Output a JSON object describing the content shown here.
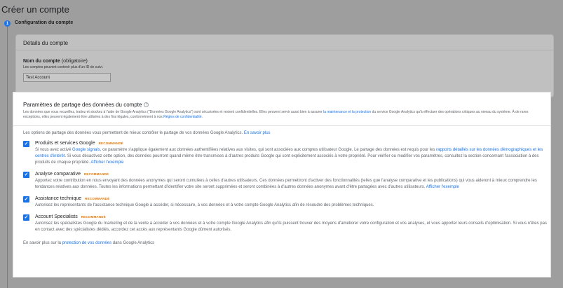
{
  "page": {
    "title": "Créer un compte",
    "step_number": "1",
    "step_label": "Configuration du compte"
  },
  "account_details": {
    "header": "Détails du compte",
    "name_label": "Nom du compte",
    "name_optional": "(obligatoire)",
    "name_help": "Les comptes peuvent contenir plus d'un ID de suivi.",
    "name_value": "Test Account"
  },
  "sharing": {
    "title": "Paramètres de partage des données du compte",
    "help_icon": "?",
    "desc_part1": "Les données que vous recueillez, traitez et stockez à l'aide de Google Analytics (\"Données Google Analytics\") sont sécurisées et restent confidentielles. Elles peuvent servir aussi bien à assurer ",
    "desc_link1": "la maintenance et la protection",
    "desc_part2": " du service Google Analytics qu'à effectuer des opérations critiques au niveau du système. À de rares exceptions, elles peuvent également être utilisées à des fins légales, conformément à nos ",
    "desc_link2": "Règles de confidentialité",
    "desc_part3": ".",
    "intro_text": "Les options de partage des données vous permettent de mieux contrôler le partage de vos données Google Analytics. ",
    "intro_link": "En savoir plus",
    "badge": "RECOMMANDÉ",
    "options": [
      {
        "title": "Produits et services Google",
        "checked": true,
        "desc_a": "Si vous avez activé ",
        "link_a": "Google signals",
        "desc_b": ", ce paramètre s'applique également aux données authentifiées relatives aux visites, qui sont associées aux comptes utilisateur Google. Le partage des données est requis pour les ",
        "link_b": "rapports détaillés sur les données démographiques et les centres d'intérêt",
        "desc_c": ". Si vous désactivez cette option, des données pourront quand même être transmises à d'autres produits Google qui sont explicitement associés à votre propriété. Pour vérifier ou modifier vos paramètres, consultez la section concernant l'association à des produits de chaque propriété. ",
        "link_c": "Afficher l'exemple"
      },
      {
        "title": "Analyse comparative",
        "checked": true,
        "desc_a": "Apportez votre contribution en nous envoyant des données anonymes qui seront cumulées à celles d'autres utilisateurs. Ces données permettront d'activer des fonctionnalités (telles que l'analyse comparative et les publications) qui vous aideront à mieux comprendre les tendances relatives aux données. Toutes les informations permettant d'identifier votre site seront supprimées et seront combinées à d'autres données anonymes avant d'être partagées avec d'autres utilisateurs. ",
        "link_a": "Afficher l'exemple"
      },
      {
        "title": "Assistance technique",
        "checked": true,
        "desc_a": "Autorisez les représentants de l'assistance technique Google à accéder, si nécessaire, à vos données et à votre compte Google Analytics afin de résoudre des problèmes techniques."
      },
      {
        "title": "Account Specialists",
        "checked": true,
        "desc_a": "Autorisez les spécialistes Google du marketing et de la vente à accéder à vos données et à votre compte Google Analytics afin qu'ils puissent trouver des moyens d'améliorer votre configuration et vos analyses, et vous apporter leurs conseils d'optimisation. Si vous n'êtes pas en contact avec des spécialistes dédiés, accordez cet accès aux représentants Google dûment autorisés."
      }
    ],
    "footer_text": "En savoir plus sur la ",
    "footer_link": "protection de vos données",
    "footer_suffix": " dans Google Analytics",
    "checkmark": "✓"
  }
}
